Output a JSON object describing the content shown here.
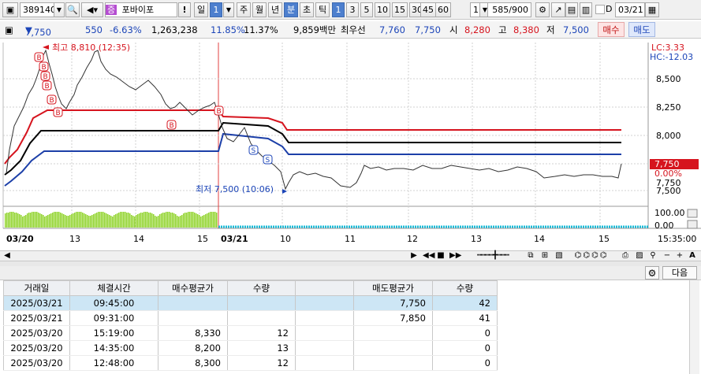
{
  "toolbar": {
    "code": "389140",
    "stock_name": "포바이포",
    "stock_tag": "증",
    "exclaim": "!",
    "period_value": "1",
    "periods": [
      "일",
      "주",
      "월",
      "년",
      "분",
      "초",
      "틱"
    ],
    "intervals": [
      "1",
      "3",
      "5",
      "10",
      "15",
      "30",
      "45",
      "60"
    ],
    "n_value": "1",
    "range": "585/900",
    "date": "03/21",
    "d_label": "D"
  },
  "quote": {
    "price": "7,750",
    "change": "550",
    "change_pct": "-6.63%",
    "volume": "1,263,238",
    "turnover_pct": "11.85%",
    "ratio_pct": "11.37%",
    "amount": "9,859백만",
    "best_label": "최우선",
    "best_ask": "7,760",
    "best_bid": "7,750",
    "open_label": "시",
    "open": "8,280",
    "high_label": "고",
    "high": "8,380",
    "low_label": "저",
    "low": "7,500",
    "buy_button": "매수",
    "sell_button": "매도"
  },
  "chart": {
    "high_note": "최고 8,810 (12:35)",
    "low_note": "최저 7,500 (10:06)",
    "lc_label": "LC:3.33",
    "hc_label": "HC:-12.03",
    "y_ticks": [
      "8,500",
      "8,250",
      "8,000",
      "7,750",
      "7,500"
    ],
    "current_price_tag": "7,750",
    "current_pct_tag": "0.00%",
    "volume_ticks": [
      "100.00",
      "0.00"
    ],
    "time_labels": [
      "03/20",
      "13",
      "14",
      "15",
      "03/21",
      "10",
      "11",
      "12",
      "13",
      "14",
      "15"
    ],
    "clock": "15:35:00",
    "marker_buy": "B",
    "marker_sell": "S"
  },
  "chart_data": {
    "type": "line",
    "title": "",
    "xlabel": "",
    "ylabel": "",
    "x": [
      "03/20 12:00",
      "03/20 12:35",
      "03/20 13:00",
      "03/20 14:00",
      "03/20 15:00",
      "03/21 09:00",
      "03/21 10:06",
      "03/21 11:00",
      "03/21 12:00",
      "03/21 13:00",
      "03/21 14:00",
      "03/21 15:00",
      "03/21 15:30"
    ],
    "series": [
      {
        "values": [
          8050,
          8810,
          8700,
          8450,
          8300,
          8200,
          7500,
          7820,
          7800,
          7780,
          7700,
          7710,
          7750
        ]
      }
    ],
    "ylim": [
      7400,
      8900
    ]
  },
  "bottom": {
    "next_button": "다음",
    "columns": [
      "거래일",
      "체결시간",
      "매수평균가",
      "수량",
      "",
      "매도평균가",
      "수량"
    ],
    "rows": [
      [
        "2025/03/21",
        "09:45:00",
        "",
        "",
        "",
        "7,750",
        "42"
      ],
      [
        "2025/03/21",
        "09:31:00",
        "",
        "",
        "",
        "7,850",
        "41"
      ],
      [
        "2025/03/20",
        "15:19:00",
        "8,330",
        "12",
        "",
        "",
        "0"
      ],
      [
        "2025/03/20",
        "14:35:00",
        "8,200",
        "13",
        "",
        "",
        "0"
      ],
      [
        "2025/03/20",
        "12:48:00",
        "8,300",
        "12",
        "",
        "",
        "0"
      ]
    ]
  },
  "colors": {
    "up": "#d6141e",
    "down": "#1c45b8",
    "accent": "#4d7fce"
  }
}
